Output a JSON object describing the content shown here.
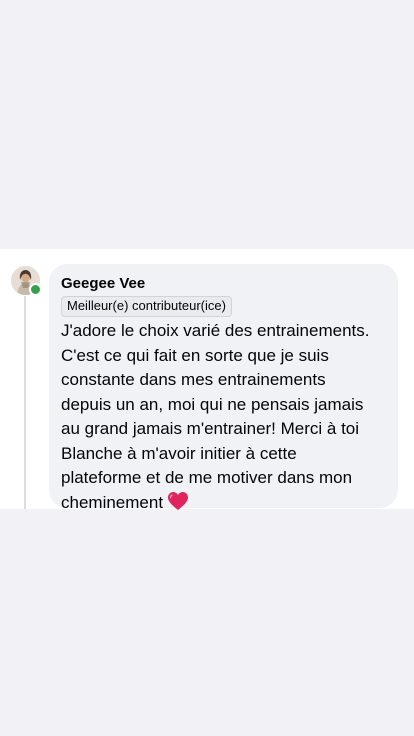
{
  "comment": {
    "author": "Geegee Vee",
    "badge": "Meilleur(e) contributeur(ice)",
    "text": "J'adore le choix varié des entrainements.\nC'est ce qui fait en sorte que je suis\nconstante dans mes entrainements\ndepuis un an, moi qui ne pensais jamais\nau grand jamais m'entrainer! Merci à toi\nBlanche à m'avoir initier à cette\nplateforme et de me motiver dans mon\ncheminement",
    "emoji": "red-heart-icon",
    "online": true
  },
  "colors": {
    "page_background": "#f2f2f6",
    "card_background": "#ffffff",
    "bubble_background": "#f0f2f5",
    "text": "#050505",
    "online_dot": "#31a24c",
    "heart": "#e0245e"
  }
}
